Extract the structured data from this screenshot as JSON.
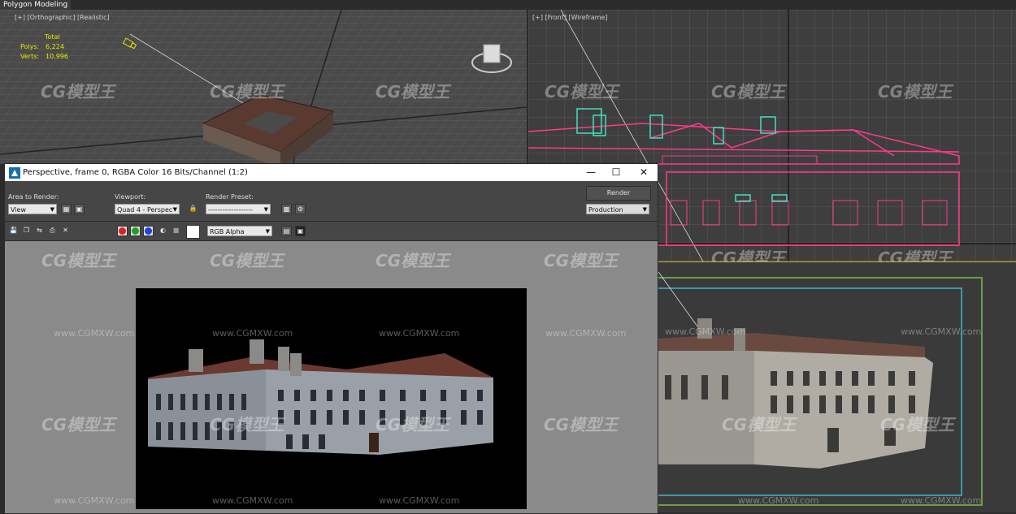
{
  "app": {
    "title": "Polygon Modeling"
  },
  "viewports": {
    "top_left": {
      "label": "[+] [Orthographic] [Realistic]",
      "stats": {
        "header": "Total",
        "polys_label": "Polys:",
        "polys_value": "6,224",
        "verts_label": "Verts:",
        "verts_value": "10,996"
      }
    },
    "top_right": {
      "label": "[+] [Front] [Wireframe]"
    }
  },
  "render_frame": {
    "title": "Perspective, frame 0, RGBA Color 16 Bits/Channel (1:2)",
    "area_to_render": {
      "label": "Area to Render:",
      "value": "View"
    },
    "viewport": {
      "label": "Viewport:",
      "value": "Quad 4 - Perspec"
    },
    "render_preset": {
      "label": "Render Preset:",
      "value": "-------------------"
    },
    "render_button": "Render",
    "production": "Production",
    "channel": "RGB Alpha",
    "colors": {
      "red": "#e02020",
      "green": "#20a020",
      "blue": "#2040e0"
    }
  },
  "watermarks": {
    "brand": "CG模型王",
    "url": "www.CGMXW.com"
  }
}
